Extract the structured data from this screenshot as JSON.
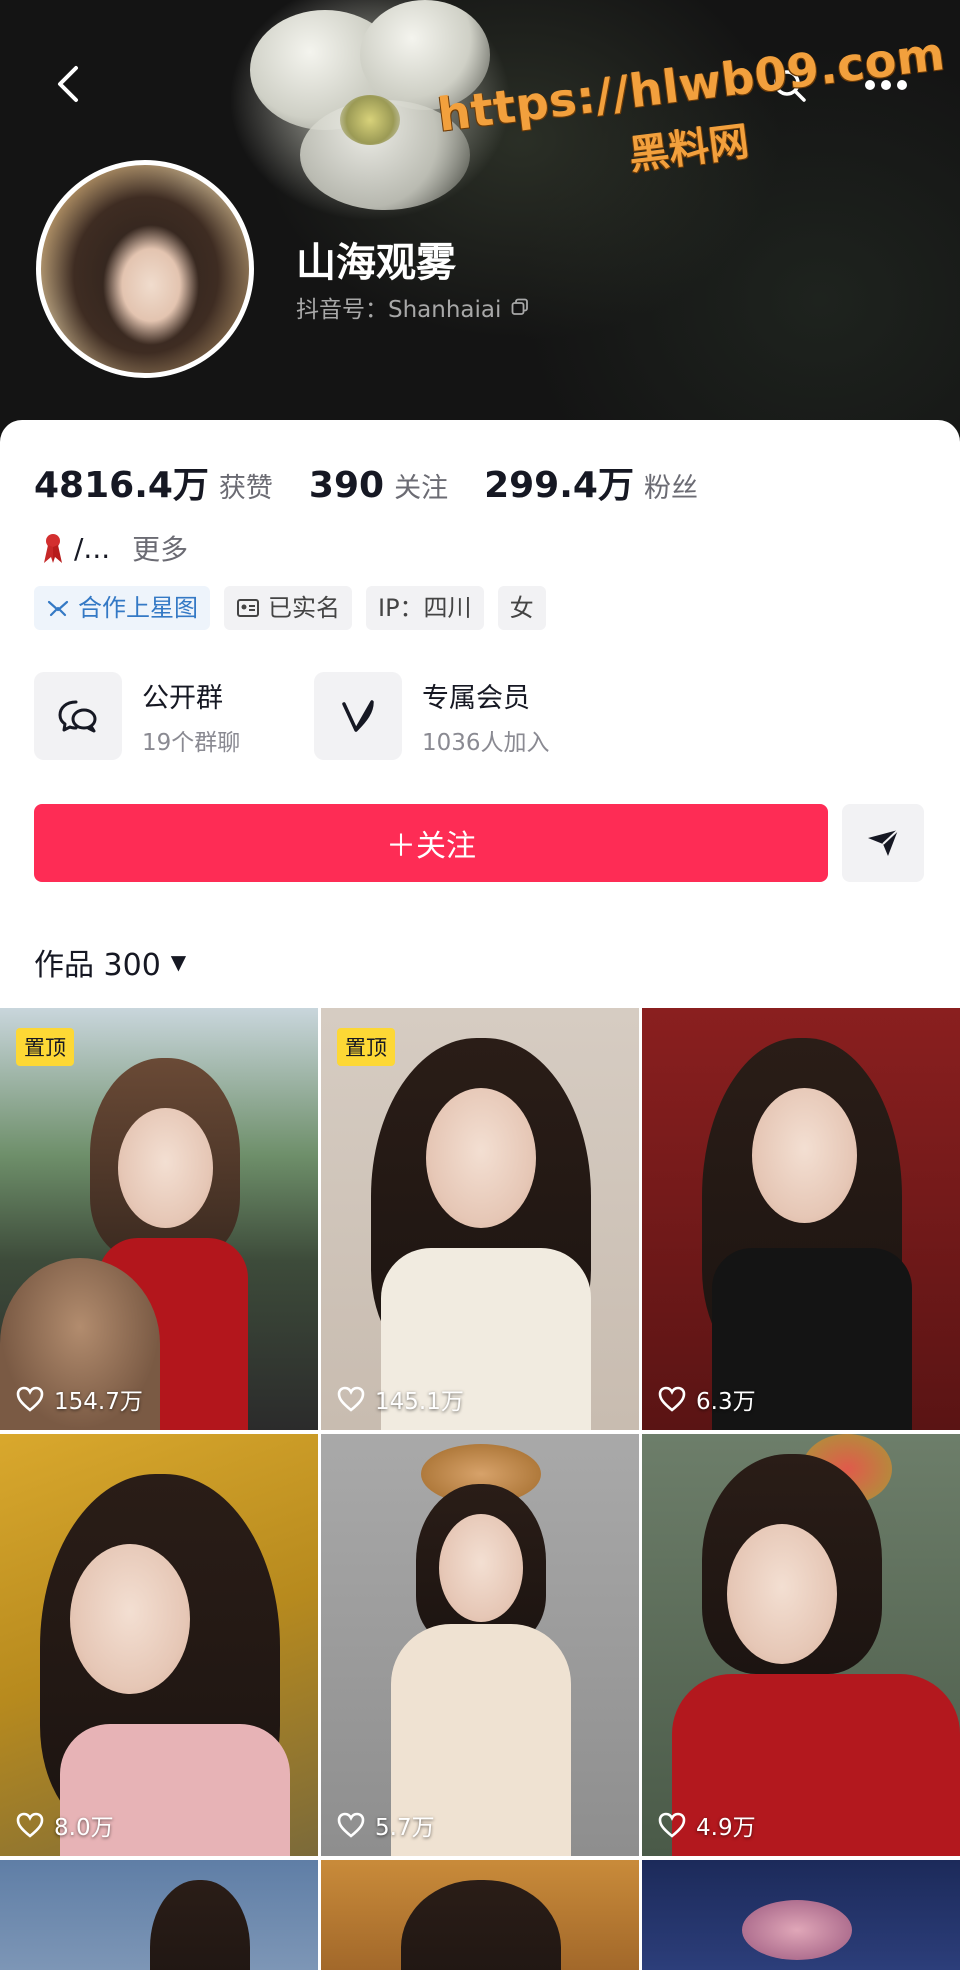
{
  "header": {
    "username": "山海观雾",
    "douyin_id": "抖音号：Shanhaiai",
    "watermark_url": "https://hlwb09.com",
    "watermark_text": "黑料网"
  },
  "stats": [
    {
      "value": "4816.4万",
      "label": "获赞"
    },
    {
      "value": "390",
      "label": "关注"
    },
    {
      "value": "299.4万",
      "label": "粉丝"
    }
  ],
  "bio": {
    "text": "/...",
    "more": "更多"
  },
  "tags": [
    "合作上星图",
    "已实名",
    "IP：四川",
    "女"
  ],
  "features": [
    {
      "title": "公开群",
      "subtitle": "19个群聊"
    },
    {
      "title": "专属会员",
      "subtitle": "1036人加入"
    }
  ],
  "follow_button": "＋关注",
  "works_tab": "作品 300",
  "videos": [
    {
      "pinned": "置顶",
      "likes": "154.7万"
    },
    {
      "pinned": "置顶",
      "likes": "145.1万"
    },
    {
      "pinned": "",
      "likes": "6.3万"
    },
    {
      "pinned": "",
      "likes": "8.0万"
    },
    {
      "pinned": "",
      "likes": "5.7万"
    },
    {
      "pinned": "",
      "likes": "4.9万"
    }
  ],
  "colors": {
    "accent": "#fe2c55",
    "pin": "#fdd835",
    "link_blue": "#3479c5"
  }
}
